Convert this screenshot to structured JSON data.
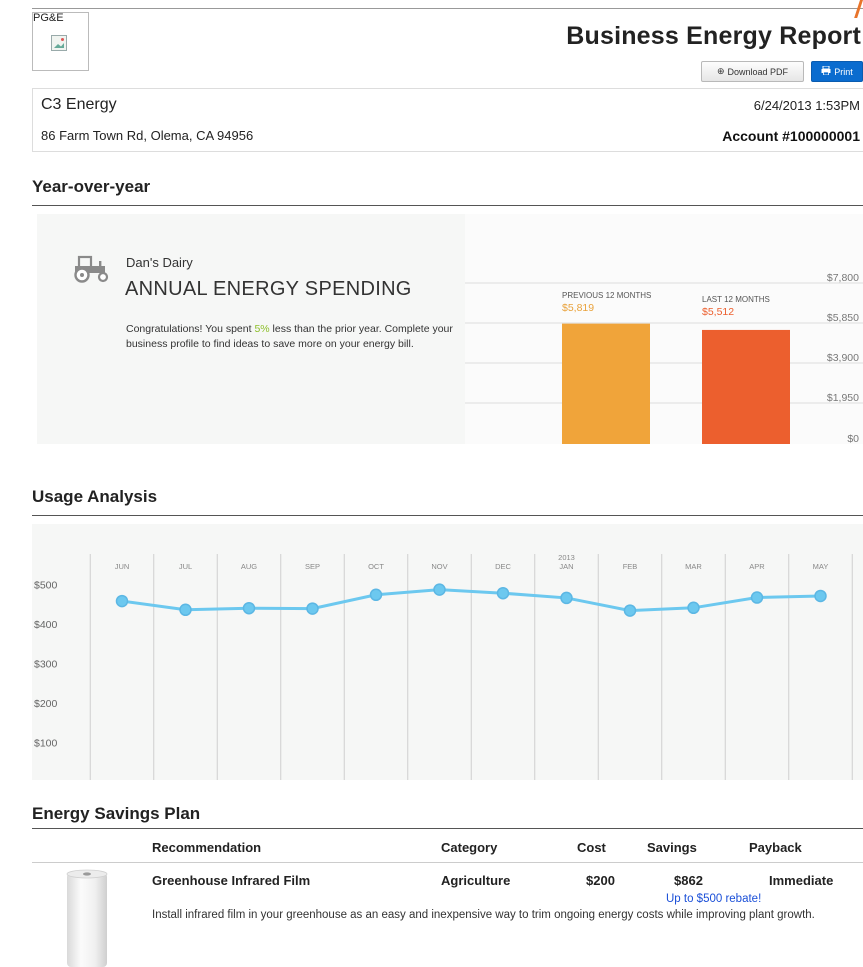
{
  "header": {
    "logo_text": "PG&E",
    "report_title": "Business Energy Report",
    "download_pdf_label": "Download PDF",
    "print_label": "Print"
  },
  "account": {
    "company": "C3 Energy",
    "address": "86 Farm Town Rd, Olema, CA 94956",
    "datetime": "6/24/2013 1:53PM",
    "account_number": "Account #100000001"
  },
  "yoy": {
    "section_title": "Year-over-year",
    "business_name": "Dan's Dairy",
    "heading": "ANNUAL ENERGY SPENDING",
    "text_before": "Congratulations! You spent ",
    "percent": "5%",
    "text_after": " less than the prior year. Complete your business profile to find ideas to save more on your energy bill."
  },
  "usage": {
    "section_title": "Usage Analysis"
  },
  "savings": {
    "section_title": "Energy Savings Plan",
    "headers": [
      "Recommendation",
      "Category",
      "Cost",
      "Savings",
      "Payback"
    ],
    "row": {
      "name": "Greenhouse Infrared Film",
      "category": "Agriculture",
      "cost": "$200",
      "savings": "$862",
      "payback": "Immediate",
      "rebate": "Up to $500 rebate!",
      "description": "Install infrared film in your greenhouse as an easy and inexpensive way to trim ongoing energy costs while improving plant growth."
    }
  },
  "colors": {
    "previous_bar": "#f0a43a",
    "last_bar": "#ec5f2e",
    "previous_value_text": "#e9a23b",
    "last_value_text": "#ec5f2e",
    "usage_line": "#6cc8ef",
    "usage_marker": "#5cb7e4",
    "accent_percent": "#8dbf2a",
    "rebate_link": "#1a4fd8",
    "print_button": "#0a6ccf"
  },
  "chart_data": [
    {
      "type": "bar",
      "categories": [
        "PREVIOUS 12 MONTHS",
        "LAST 12 MONTHS"
      ],
      "values": [
        5819,
        5512
      ],
      "value_labels": [
        "$5,819",
        "$5,512"
      ],
      "y_ticks": [
        "$0",
        "$1,950",
        "$3,900",
        "$5,850",
        "$7,800"
      ],
      "ylim": [
        0,
        7800
      ],
      "grid": true
    },
    {
      "type": "line",
      "categories": [
        "JUN",
        "JUL",
        "AUG",
        "SEP",
        "OCT",
        "NOV",
        "DEC",
        "JAN",
        "FEB",
        "MAR",
        "APR",
        "MAY"
      ],
      "year_marker": {
        "category": "JAN",
        "label": "2013"
      },
      "values": [
        458,
        436,
        440,
        439,
        474,
        487,
        478,
        466,
        434,
        441,
        467,
        471
      ],
      "y_ticks": [
        "$100",
        "$200",
        "$300",
        "$400",
        "$500"
      ],
      "ylim": [
        0,
        550
      ],
      "grid": true
    }
  ]
}
